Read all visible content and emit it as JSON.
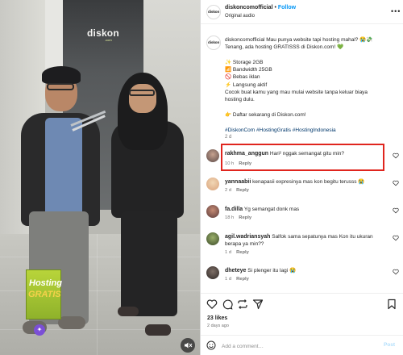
{
  "media": {
    "store_sign": "diskon",
    "store_sign_sub": ".com",
    "book_title_1": "Hosting",
    "book_title_2": "GRATIS",
    "mute_icon": "speaker-muted-icon"
  },
  "post_header": {
    "username": "diskoncomofficial",
    "separator": "•",
    "follow_label": "Follow",
    "audio_label": "Original audio",
    "more_icon": "more-horizontal-icon"
  },
  "caption": {
    "username": "diskoncomofficial",
    "lines": [
      "Mau punya website tapi hosting mahal? 😭💸",
      "Tenang, ada hosting GRATISSS di Diskon.com! 💚",
      "",
      "✨ Storage 2GB",
      "📶 Bandwidth 25GB",
      "🚫 Bebas iklan",
      "⚡ Langsung aktif",
      "Cocok buat kamu yang mau mulai website tanpa keluar biaya",
      "hosting dulu.",
      "",
      "👉 Daftar sekarang di Diskon.com!"
    ],
    "hashtags": "#DiskonCom #HostingGratis #HostingIndonesia",
    "age": "2 d"
  },
  "comments": [
    {
      "username": "rakhma_anggun",
      "text": "Hari² nggak semangat gitu min?",
      "age": "10 h",
      "reply_label": "Reply",
      "highlighted": true
    },
    {
      "username": "yannaabii",
      "text": "kenapasii expresinya mas kon begitu terusss 😭",
      "age": "2 d",
      "reply_label": "Reply"
    },
    {
      "username": "fa.dilla",
      "text": "Yg semangat donk mas",
      "age": "18 h",
      "reply_label": "Reply"
    },
    {
      "username": "agil.wadriansyah",
      "text": "Salfok sama sepatunya mas Kon itu ukuran berapa ya min??",
      "age": "1 d",
      "reply_label": "Reply"
    },
    {
      "username": "dheteye",
      "text": "Si plenger itu lagi 😭",
      "age": "1 d",
      "reply_label": "Reply"
    }
  ],
  "actions": {
    "like_icon": "heart-icon",
    "comment_icon": "comment-bubble-icon",
    "repost_icon": "repost-icon",
    "share_icon": "paper-plane-icon",
    "save_icon": "bookmark-icon",
    "likes_text": "23 likes",
    "posted_ago": "2 days ago"
  },
  "add_comment": {
    "placeholder": "Add a comment…",
    "post_label": "Post",
    "emoji_icon": "smiley-icon"
  },
  "colors": {
    "link_blue": "#0095f6",
    "hashtag": "#00376b",
    "highlight_box": "#e0251e",
    "muted_text": "#737373"
  }
}
